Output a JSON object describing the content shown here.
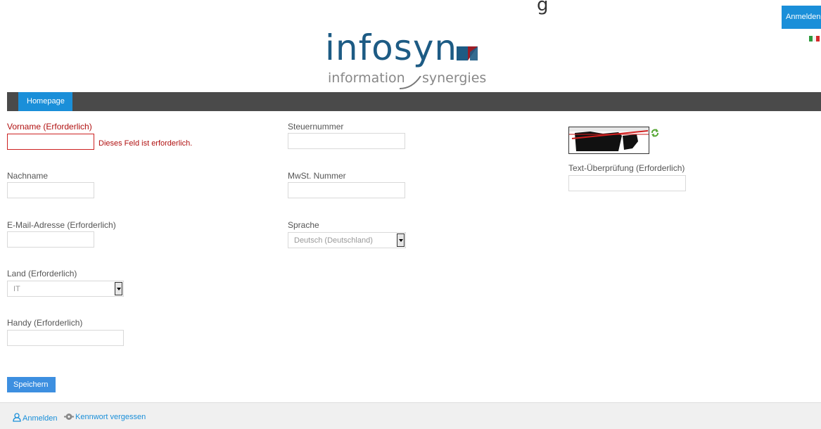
{
  "header": {
    "cut_title": "g",
    "login_button": "Anmelden",
    "logo": {
      "brand": "infosyn",
      "tagline_left": "information",
      "tagline_right": "synergies"
    },
    "flag_icon": "italian-flag-icon"
  },
  "nav": {
    "tabs": [
      {
        "label": "Homepage",
        "active": true
      }
    ]
  },
  "form": {
    "vorname": {
      "label": "Vorname (Erforderlich)",
      "value": "",
      "error": "Dieses Feld ist erforderlich."
    },
    "nachname": {
      "label": "Nachname",
      "value": ""
    },
    "email": {
      "label": "E-Mail-Adresse (Erforderlich)",
      "value": ""
    },
    "land": {
      "label": "Land (Erforderlich)",
      "selected": "IT"
    },
    "handy": {
      "label": "Handy (Erforderlich)",
      "value": ""
    },
    "steuernummer": {
      "label": "Steuernummer",
      "value": ""
    },
    "mwst": {
      "label": "MwSt. Nummer",
      "value": ""
    },
    "sprache": {
      "label": "Sprache",
      "selected": "Deutsch (Deutschland)"
    },
    "captcha": {
      "label": "Text-Überprüfung (Erforderlich)",
      "value": "",
      "refresh_icon": "refresh-icon"
    },
    "save_label": "Speichern"
  },
  "footer": {
    "links": [
      {
        "label": "Anmelden",
        "icon": "user-icon"
      },
      {
        "label": "Kennwort vergessen",
        "icon": "key-icon"
      }
    ]
  },
  "colors": {
    "accent": "#1a8fd9",
    "navbar": "#4a4a4a",
    "error": "#b01010",
    "logo_blue": "#1d5b84",
    "logo_red": "#9b1b25"
  }
}
